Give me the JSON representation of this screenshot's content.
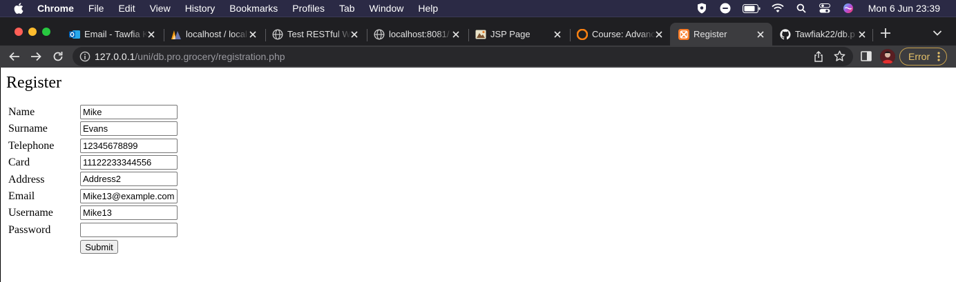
{
  "menubar": {
    "items": [
      "Chrome",
      "File",
      "Edit",
      "View",
      "History",
      "Bookmarks",
      "Profiles",
      "Tab",
      "Window",
      "Help"
    ],
    "clock": "Mon 6 Jun  23:39"
  },
  "tabs": [
    {
      "title": "Email - Tawfia K",
      "icon": "outlook-icon",
      "active": false
    },
    {
      "title": "localhost / local",
      "icon": "phpmyadmin-icon",
      "active": false
    },
    {
      "title": "Test RESTful We",
      "icon": "globe-icon",
      "active": false
    },
    {
      "title": "localhost:8081/",
      "icon": "globe-icon",
      "active": false
    },
    {
      "title": "JSP Page",
      "icon": "jsp-icon",
      "active": false
    },
    {
      "title": "Course: Advanc",
      "icon": "moodle-icon",
      "active": false
    },
    {
      "title": "Register",
      "icon": "xampp-icon",
      "active": true
    },
    {
      "title": "Tawfiak22/db.p",
      "icon": "github-icon",
      "active": false
    }
  ],
  "toolbar": {
    "url_host": "127.0.0.1",
    "url_path": "/uni/db.pro.grocery/registration.php",
    "error_label": "Error"
  },
  "form": {
    "heading": "Register",
    "fields": [
      {
        "label": "Name",
        "value": "Mike"
      },
      {
        "label": "Surname",
        "value": "Evans"
      },
      {
        "label": "Telephone",
        "value": "12345678899"
      },
      {
        "label": "Card",
        "value": "11122233344556"
      },
      {
        "label": "Address",
        "value": "Address2"
      },
      {
        "label": "Email",
        "value": "Mike13@example.com"
      },
      {
        "label": "Username",
        "value": "Mike13"
      },
      {
        "label": "Password",
        "value": ""
      }
    ],
    "submit_label": "Submit"
  },
  "colors": {
    "menubar_bg": "#2b2a45",
    "tabstrip_bg": "#1f1f22",
    "toolbar_bg": "#3c3c3f",
    "error_accent": "#e8c36a"
  }
}
